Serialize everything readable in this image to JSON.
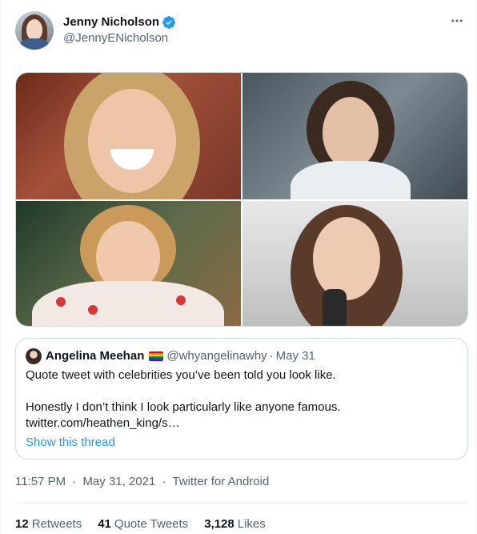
{
  "tweet": {
    "author": {
      "display_name": "Jenny Nicholson",
      "handle": "@JennyENicholson",
      "verified": true
    },
    "more_icon": "more-horizontal-icon",
    "media": {
      "count": 4,
      "images": [
        "photo-1",
        "photo-2",
        "photo-3",
        "photo-4"
      ]
    },
    "quoted_tweet": {
      "author_name": "Angelina Meehan",
      "flag_emoji": "🏳️‍🌈",
      "handle": "@whyangelinawhy",
      "separator": "·",
      "date": "May 31",
      "text_line1": "Quote tweet with celebrities you’ve been told you look like.",
      "text_line2": "Honestly I don’t think I look particularly like anyone famous.",
      "text_line3": "twitter.com/heathen_king/s…",
      "show_thread": "Show this thread"
    },
    "timestamp": {
      "time": "11:57 PM",
      "separator1": "·",
      "date": "May 31, 2021",
      "separator2": "·",
      "source": "Twitter for Android"
    },
    "stats": {
      "retweets_count": "12",
      "retweets_label": "Retweets",
      "quote_count": "41",
      "quote_label": "Quote Tweets",
      "likes_count": "3,128",
      "likes_label": "Likes"
    }
  },
  "colors": {
    "accent": "#1d9bf0",
    "secondary_text": "#536471",
    "primary_text": "#0f1419",
    "border": "#cfd9de"
  }
}
